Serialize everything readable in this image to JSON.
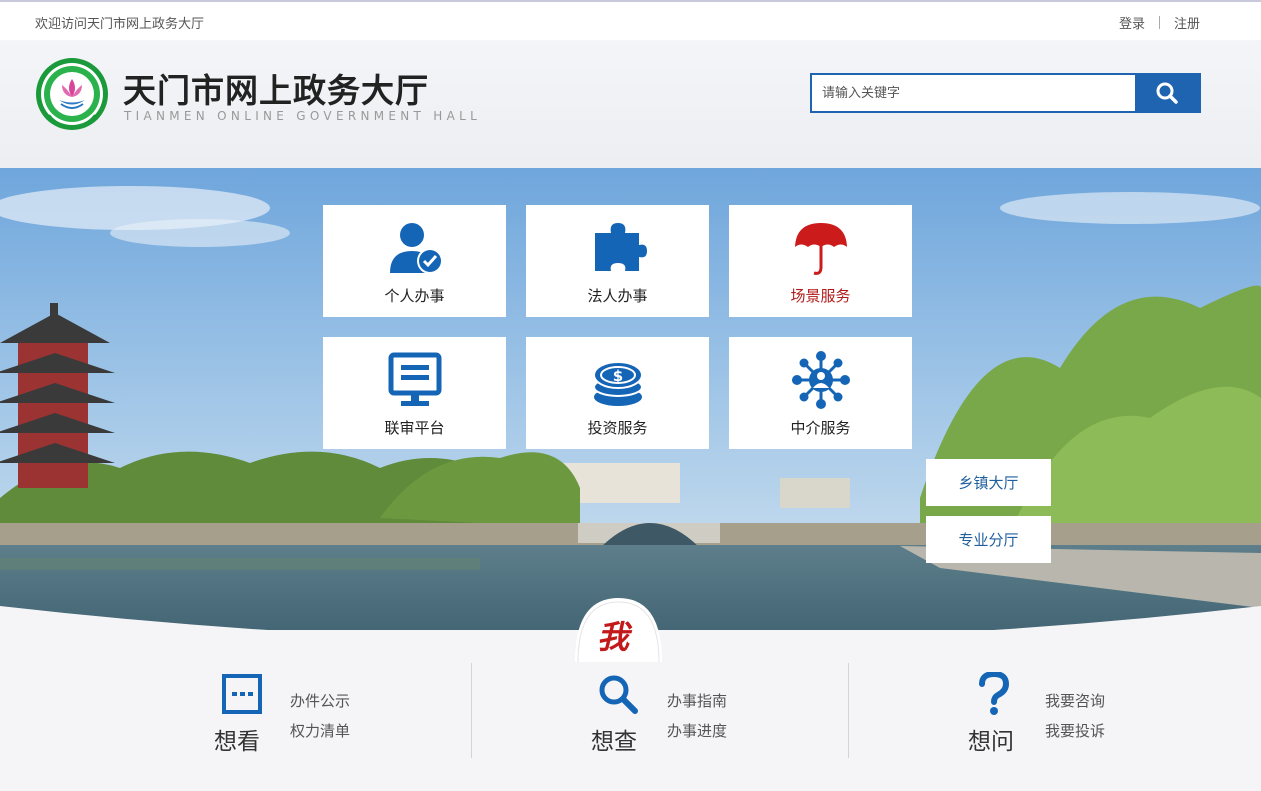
{
  "topbar": {
    "welcome": "欢迎访问天门市网上政务大厅",
    "login": "登录",
    "register": "注册"
  },
  "header": {
    "title": "天门市网上政务大厅",
    "subtitle": "TIANMEN ONLINE GOVERNMENT HALL",
    "search_placeholder": "请输入关键字",
    "logo_icon": "lotus-emblem-icon"
  },
  "services": [
    {
      "label": "个人办事",
      "icon": "person-check-icon"
    },
    {
      "label": "法人办事",
      "icon": "puzzle-icon"
    },
    {
      "label": "场景服务",
      "icon": "umbrella-icon"
    },
    {
      "label": "联审平台",
      "icon": "monitor-icon"
    },
    {
      "label": "投资服务",
      "icon": "coin-stack-icon"
    },
    {
      "label": "中介服务",
      "icon": "network-icon"
    }
  ],
  "side_buttons": {
    "township": "乡镇大厅",
    "special": "专业分厅"
  },
  "badge": "我",
  "bottom": {
    "see": {
      "title": "想看",
      "links": [
        "办件公示",
        "权力清单"
      ],
      "icon": "message-box-icon"
    },
    "check": {
      "title": "想查",
      "links": [
        "办事指南",
        "办事进度"
      ],
      "icon": "magnifier-icon"
    },
    "ask": {
      "title": "想问",
      "links": [
        "我要咨询",
        "我要投诉"
      ],
      "icon": "question-icon"
    }
  },
  "colors": {
    "brand_blue": "#1f64b0",
    "scene_red": "#b11a1a",
    "icon_blue": "#1565b6"
  }
}
